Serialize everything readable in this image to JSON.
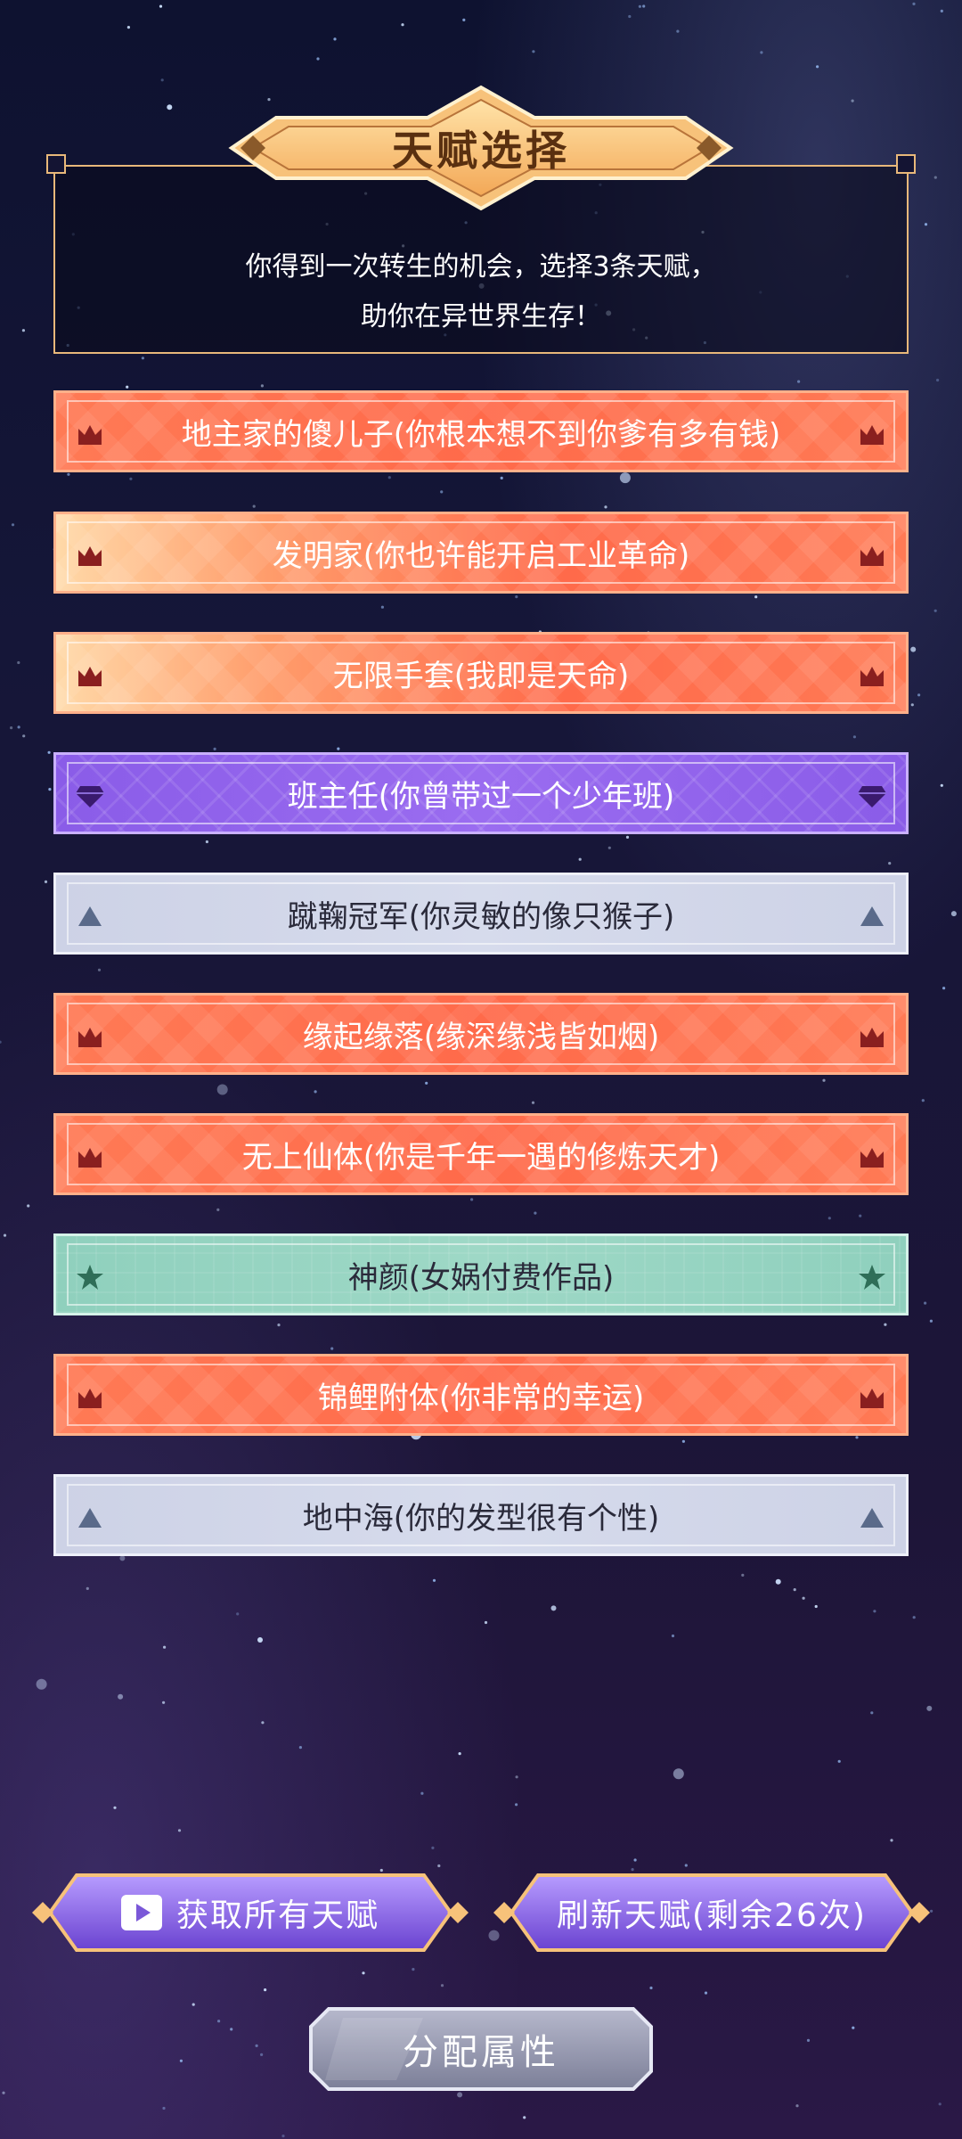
{
  "header": {
    "title": "天赋选择",
    "subtitle_line1": "你得到一次转生的机会，选择3条天赋，",
    "subtitle_line2": "助你在异世界生存！"
  },
  "talents": [
    {
      "label": "地主家的傻儿子(你根本想不到你爹有多有钱)",
      "tier": "orange",
      "icon": "crown-icon"
    },
    {
      "label": "发明家(你也许能开启工业革命)",
      "tier": "orange",
      "icon": "crown-icon"
    },
    {
      "label": "无限手套(我即是天命)",
      "tier": "orange",
      "icon": "crown-icon"
    },
    {
      "label": "班主任(你曾带过一个少年班)",
      "tier": "purple",
      "icon": "gem-icon"
    },
    {
      "label": "蹴鞠冠军(你灵敏的像只猴子)",
      "tier": "grey",
      "icon": "triangle-icon"
    },
    {
      "label": "缘起缘落(缘深缘浅皆如烟)",
      "tier": "orange",
      "icon": "crown-icon"
    },
    {
      "label": "无上仙体(你是千年一遇的修炼天才)",
      "tier": "orange",
      "icon": "crown-icon"
    },
    {
      "label": "神颜(女娲付费作品)",
      "tier": "green",
      "icon": "star-icon"
    },
    {
      "label": "锦鲤附体(你非常的幸运)",
      "tier": "orange",
      "icon": "crown-icon"
    },
    {
      "label": "地中海(你的发型很有个性)",
      "tier": "grey",
      "icon": "triangle-icon"
    }
  ],
  "buttons": {
    "get_all": "获取所有天赋",
    "refresh": "刷新天赋(剩余26次)",
    "assign": "分配属性"
  },
  "colors": {
    "orange": "#ff6a4a",
    "purple": "#8a5ce8",
    "grey": "#cdd2e6",
    "green": "#9ed8c6",
    "gold": "#f7c27a",
    "background": "#151638"
  }
}
